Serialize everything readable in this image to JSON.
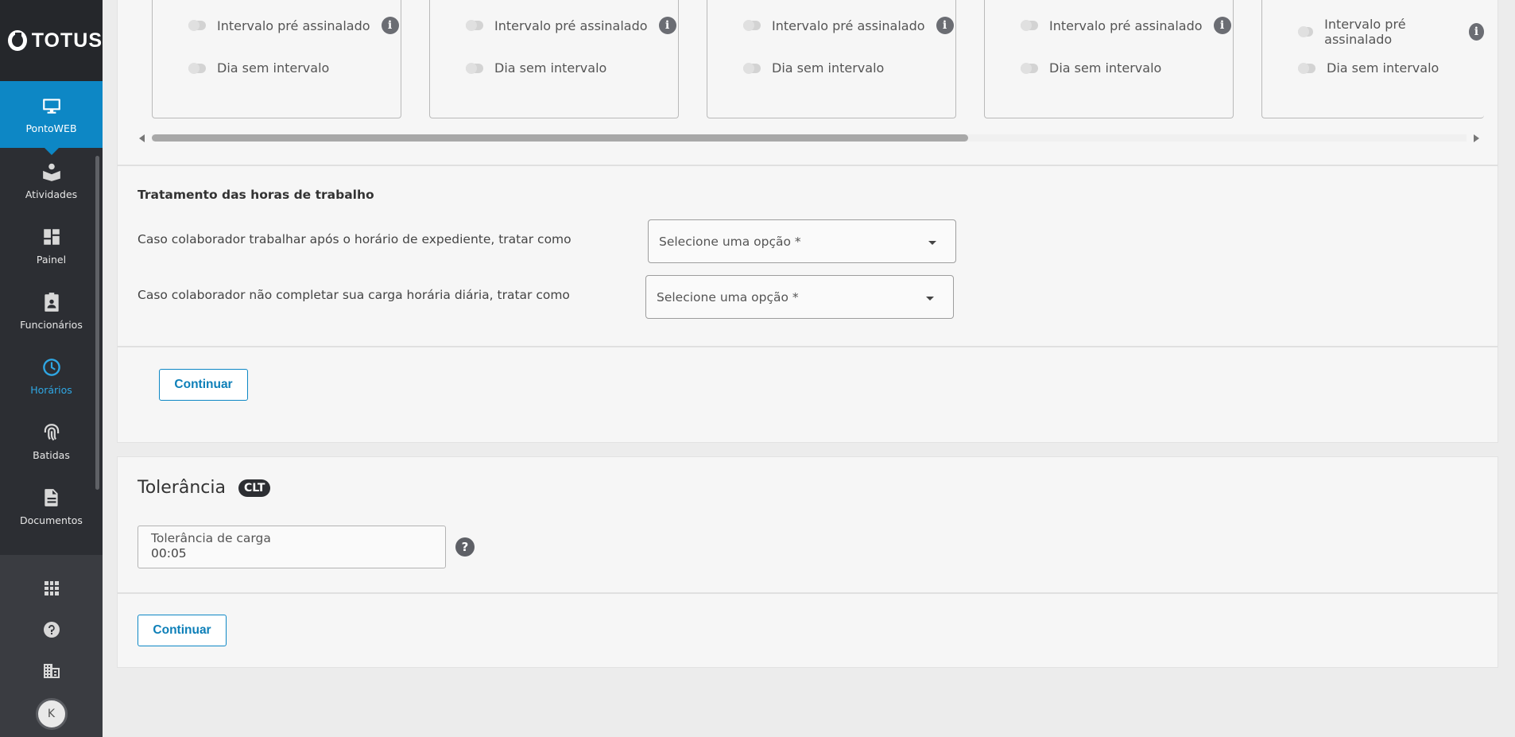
{
  "sidebar": {
    "brand": "TOTUS",
    "items": [
      {
        "label": "PontoWEB",
        "icon": "monitor-icon"
      },
      {
        "label": "Atividades",
        "icon": "book-user-icon"
      },
      {
        "label": "Painel",
        "icon": "dashboard-icon"
      },
      {
        "label": "Funcionários",
        "icon": "badge-icon"
      },
      {
        "label": "Horários",
        "icon": "clock-icon"
      },
      {
        "label": "Batidas",
        "icon": "fingerprint-icon"
      },
      {
        "label": "Documentos",
        "icon": "document-icon"
      }
    ],
    "avatar_initial": "K",
    "accent_color": "#0d87c5"
  },
  "day_cards": {
    "toggle_pre_assigned": "Intervalo pré assinalado",
    "toggle_no_break": "Dia sem intervalo"
  },
  "work_hours": {
    "title": "Tratamento das horas de trabalho",
    "row1_label": "Caso colaborador trabalhar após o horário de expediente, tratar como",
    "row1_select": "Selecione uma opção *",
    "row2_label": "Caso colaborador não completar sua carga horária diária, tratar como",
    "row2_select": "Selecione uma opção *",
    "continue_label": "Continuar"
  },
  "tolerance": {
    "title": "Tolerância",
    "badge": "CLT",
    "field_label": "Tolerância de carga",
    "field_value": "00:05",
    "continue_label": "Continuar"
  }
}
